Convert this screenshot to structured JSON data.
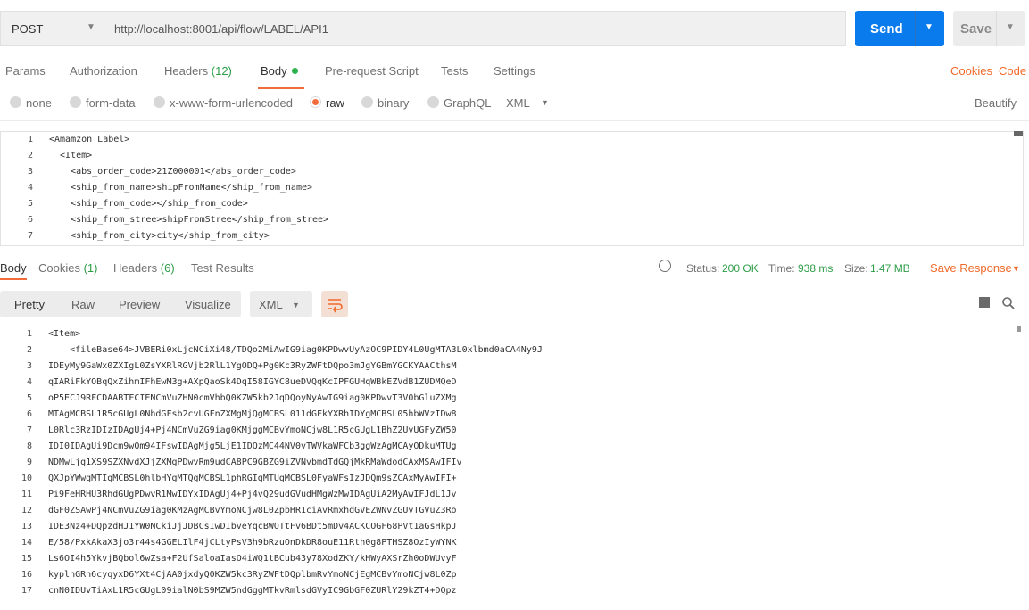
{
  "request": {
    "method": "POST",
    "url": "http://localhost:8001/api/flow/LABEL/API1",
    "send_label": "Send",
    "save_label": "Save"
  },
  "tabs": {
    "params": "Params",
    "authorization": "Authorization",
    "headers": "Headers",
    "headers_count": "(12)",
    "body": "Body",
    "prerequest": "Pre-request Script",
    "tests": "Tests",
    "settings": "Settings",
    "cookies": "Cookies",
    "code": "Code"
  },
  "body_types": {
    "none": "none",
    "form_data": "form-data",
    "urlencoded": "x-www-form-urlencoded",
    "raw": "raw",
    "binary": "binary",
    "graphql": "GraphQL",
    "format": "XML",
    "beautify": "Beautify"
  },
  "request_body": {
    "line_numbers": [
      "1",
      "2",
      "3",
      "4",
      "5",
      "6",
      "7"
    ],
    "lines": [
      "<Amamzon_Label>",
      "  <Item>",
      "    <abs_order_code>21Z000001</abs_order_code>",
      "    <ship_from_name>shipFromName</ship_from_name>",
      "    <ship_from_code></ship_from_code>",
      "    <ship_from_stree>shipFromStree</ship_from_stree>",
      "    <ship_from_city>city</ship_from_city>"
    ]
  },
  "response_tabs": {
    "body": "Body",
    "cookies": "Cookies",
    "cookies_count": "(1)",
    "headers": "Headers",
    "headers_count": "(6)",
    "test_results": "Test Results"
  },
  "response_meta": {
    "status_label": "Status:",
    "status_value": "200 OK",
    "time_label": "Time:",
    "time_value": "938 ms",
    "size_label": "Size:",
    "size_value": "1.47 MB",
    "save_response": "Save Response"
  },
  "view_modes": {
    "pretty": "Pretty",
    "raw": "Raw",
    "preview": "Preview",
    "visualize": "Visualize",
    "format": "XML"
  },
  "response_body": {
    "line_numbers": [
      "1",
      "2",
      "3",
      "4",
      "5",
      "6",
      "7",
      "8",
      "9",
      "10",
      "11",
      "12",
      "13",
      "14",
      "15",
      "16",
      "17"
    ],
    "lines": [
      "<Item>",
      "    <fileBase64>JVBERi0xLjcNCiXi48/TDQo2MiAwIG9iag0KPDwvUyAzOC9PIDY4L0UgMTA3L0xlbmd0aCA4Ny9J",
      "IDEyMy9GaWx0ZXIgL0ZsYXRlRGVjb2RlL1YgODQ+Pg0Kc3RyZWFtDQpo3mJgYGBmYGCKYAACthsM",
      "qIARiFkYOBqQxZihmIFhEwM3g+AXpQaoSk4DqI58IGYC8ueDVQqKcIPFGUHqWBkEZVdB1ZUDMQeD",
      "oP5ECJ9RFCDAABTFCIENCmVuZHN0cmVhbQ0KZW5kb2JqDQoyNyAwIG9iag0KPDwvT3V0bGluZXMg",
      "MTAgMCBSL1R5cGUgL0NhdGFsb2cvUGFnZXMgMjQgMCBSL011dGFkYXRhIDYgMCBSL05hbWVzIDw8",
      "L0Rlc3RzIDIzIDAgUj4+Pj4NCmVuZG9iag0KMjggMCBvYmoNCjw8L1R5cGUgL1BhZ2UvUGFyZW50",
      "IDI0IDAgUi9Dcm9wQm94IFswIDAgMjg5LjE1IDQzMC44NV0vTWVkaWFCb3ggWzAgMCAyODkuMTUg",
      "NDMwLjg1XS9SZXNvdXJjZXMgPDwvRm9udCA8PC9GBZG9iZVNvbmdTdGQjMkRMaWdodCAxMSAwIFIv",
      "QXJpYWwgMTIgMCBSL0hlbHYgMTQgMCBSL1phRGIgMTUgMCBSL0FyaWFsIzJDQm9sZCAxMyAwIFI+",
      "Pi9FeHRHU3RhdGUgPDwvR1MwIDYxIDAgUj4+Pj4vQ29udGVudHMgWzMwIDAgUiA2MyAwIFJdL1Jv",
      "dGF0ZSAwPj4NCmVuZG9iag0KMzAgMCBvYmoNCjw8L0ZpbHR1ciAvRmxhdGVEZWNvZGUvTGVuZ3Ro",
      "IDE3Nz4+DQpzdHJ1YW0NCkiJjJDBCsIwDIbveYqcBWOTtFv6BDt5mDv4ACKCOGF68PVt1aGsHkpJ",
      "E/58/PxkAkaX3jo3r44s4GGELIlF4jCLtyPsV3h9bRzuOnDkDR8ouE11Rth0g8PTHSZ8OzIyWYNK",
      "Ls6OI4h5YkvjBQbol6wZsa+F2UfSaloaIasO4iWQ1tBCub43y78XodZKY/kHWyAXSrZh0oDWUvyF",
      "kyplhGRh6cyqyxD6YXt4CjAA0jxdyQ0KZW5kc3RyZWFtDQplbmRvYmoNCjEgMCBvYmoNCjw8L0Zp",
      "cnN0IDUvTiAxL1R5cGUgL09ialN0bS9MZW5ndGggMTkvRmlsdGVyIC9GbGF0ZURlY29kZT4+DQpz"
    ]
  }
}
